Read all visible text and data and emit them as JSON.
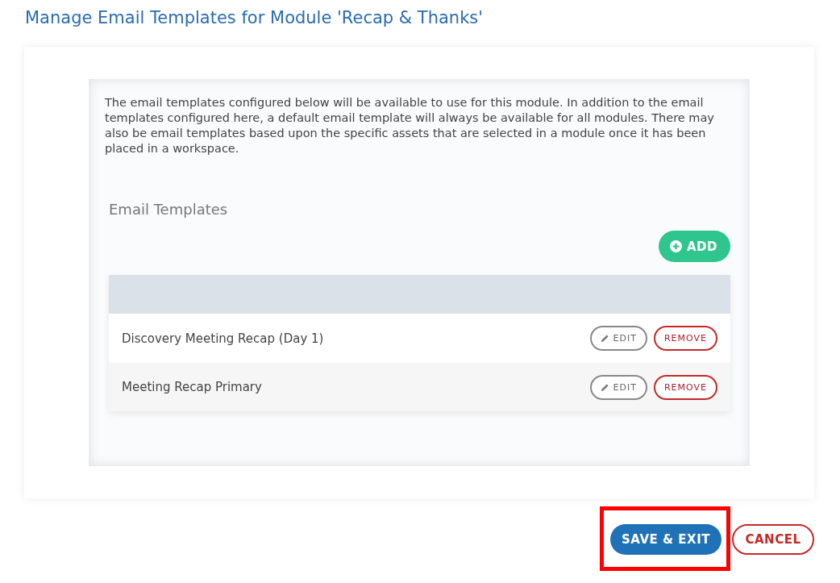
{
  "title": "Manage Email Templates for Module 'Recap & Thanks'",
  "description": "The email templates configured below will be available to use for this module. In addition to the email templates configured here, a default email template will always be available for all modules. There may also be email templates based upon the specific assets that are selected in a module once it has been placed in a workspace.",
  "section_title": "Email Templates",
  "add_button": "ADD",
  "templates": [
    {
      "name": "Discovery Meeting Recap (Day 1)",
      "edit": "EDIT",
      "remove": "REMOVE"
    },
    {
      "name": "Meeting Recap Primary",
      "edit": "EDIT",
      "remove": "REMOVE"
    }
  ],
  "footer_buttons": [
    {
      "label": "SAVE & EXIT",
      "kind": "primary",
      "highlighted": true
    },
    {
      "label": "CANCEL",
      "kind": "cancel",
      "highlighted": false
    }
  ]
}
